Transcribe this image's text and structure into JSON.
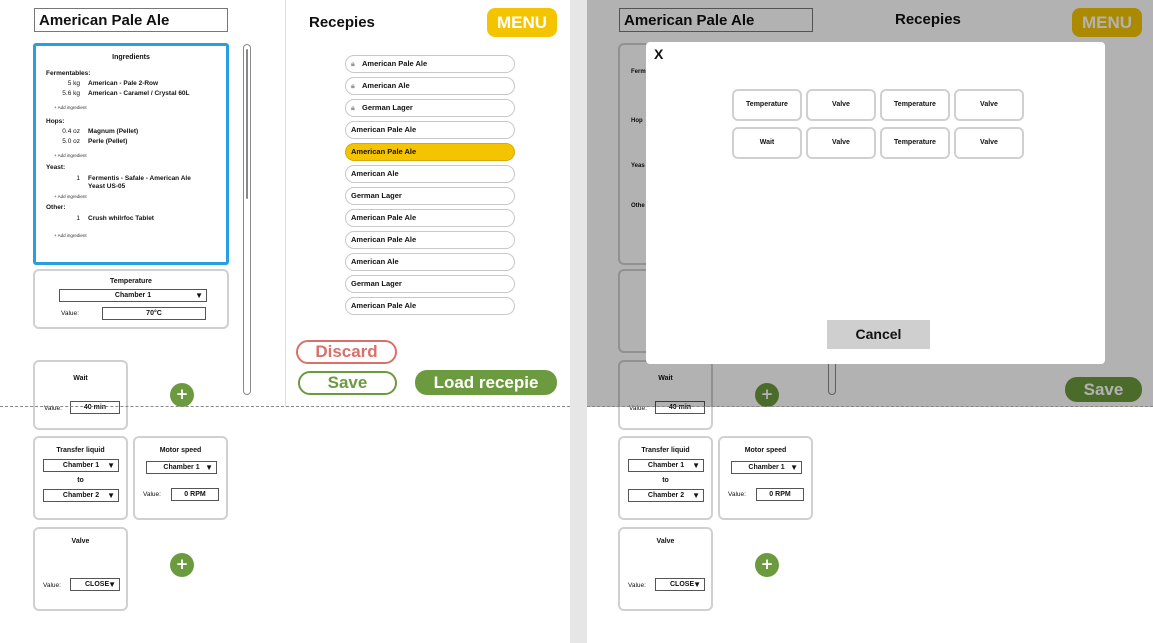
{
  "left": {
    "name_value": "American Pale Ale",
    "ingredients": {
      "title": "Ingredients",
      "add_label": "+ Add ingredient",
      "fermentables_label": "Fermentables:",
      "fermentables": [
        {
          "qty": "5 kg",
          "name": "American - Pale 2-Row"
        },
        {
          "qty": "5.6 kg",
          "name": "American - Caramel / Crystal 60L"
        }
      ],
      "hops_label": "Hops:",
      "hops": [
        {
          "qty": "0.4 oz",
          "name": "Magnum (Pellet)"
        },
        {
          "qty": "5.0 oz",
          "name": "Perle (Pellet)"
        }
      ],
      "yeast_label": "Yeast:",
      "yeast": {
        "qty": "1",
        "name_line1": "Fermentis - Safale - American Ale",
        "name_line2": "Yeast US-05"
      },
      "other_label": "Other:",
      "other": {
        "qty": "1",
        "name": "Crush whilrfoc Tablet"
      }
    },
    "temperature": {
      "title": "Temperature",
      "chamber": "Chamber 1",
      "value_label": "Value:",
      "value": "70°C"
    },
    "wait": {
      "title": "Wait",
      "value_label": "Value:",
      "value": "40 min"
    },
    "transfer": {
      "title": "Transfer liquid",
      "from": "Chamber 1",
      "to_label": "to",
      "to": "Chamber 2"
    },
    "motor": {
      "title": "Motor speed",
      "chamber": "Chamber 1",
      "value_label": "Value:",
      "value": "0 RPM"
    },
    "valve": {
      "title": "Valve",
      "value_label": "Value:",
      "value": "CLOSE"
    },
    "plus": "+"
  },
  "recipes": {
    "title": "Recepies",
    "menu": "MENU",
    "items": [
      {
        "label": "American Pale Ale",
        "locked": true,
        "selected": false
      },
      {
        "label": "American Ale",
        "locked": true,
        "selected": false
      },
      {
        "label": "German Lager",
        "locked": true,
        "selected": false
      },
      {
        "label": "American Pale Ale",
        "locked": false,
        "selected": false
      },
      {
        "label": "American Pale Ale",
        "locked": false,
        "selected": true
      },
      {
        "label": "American Ale",
        "locked": false,
        "selected": false
      },
      {
        "label": "German Lager",
        "locked": false,
        "selected": false
      },
      {
        "label": "American Pale Ale",
        "locked": false,
        "selected": false
      },
      {
        "label": "American Pale Ale",
        "locked": false,
        "selected": false
      },
      {
        "label": "American Ale",
        "locked": false,
        "selected": false
      },
      {
        "label": "German Lager",
        "locked": false,
        "selected": false
      },
      {
        "label": "American Pale Ale",
        "locked": false,
        "selected": false
      }
    ],
    "discard": "Discard",
    "save": "Save",
    "load": "Load recepie"
  },
  "modal": {
    "close": "X",
    "options": [
      "Temperature",
      "Valve",
      "Temperature",
      "Valve",
      "Wait",
      "Valve",
      "Temperature",
      "Valve"
    ],
    "cancel": "Cancel"
  },
  "colors": {
    "accent_yellow": "#f5c400",
    "green": "#6c9a3e",
    "discard_red": "#d9706a",
    "selection_blue": "#2a9fe0"
  }
}
